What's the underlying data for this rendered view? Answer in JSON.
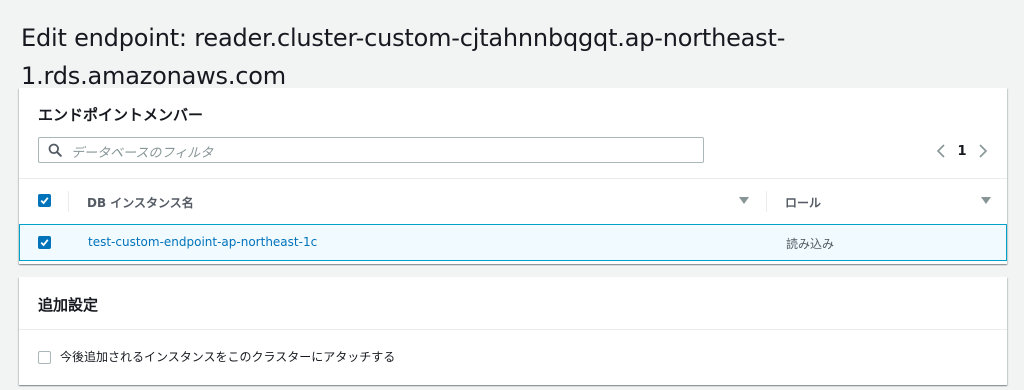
{
  "page": {
    "title": "Edit endpoint: reader.cluster-custom-cjtahnnbqgqt.ap-northeast-1.rds.amazonaws.com"
  },
  "members": {
    "header": "エンドポイントメンバー",
    "search": {
      "placeholder": "データベースのフィルタ",
      "value": ""
    },
    "pagination": {
      "current_page": "1"
    },
    "table": {
      "columns": [
        "DB インスタンス名",
        "ロール"
      ],
      "select_all_checked": true,
      "rows": [
        {
          "checked": true,
          "instance_name": "test-custom-endpoint-ap-northeast-1c",
          "role": "読み込み"
        }
      ]
    }
  },
  "settings": {
    "header": "追加設定",
    "attach_future_instances": {
      "label": "今後追加されるインスタンスをこのクラスターにアタッチする",
      "checked": false
    }
  },
  "colors": {
    "accent": "#0073bb",
    "selected_row_bg": "#f1faff",
    "selected_row_border": "#00a1c9"
  }
}
